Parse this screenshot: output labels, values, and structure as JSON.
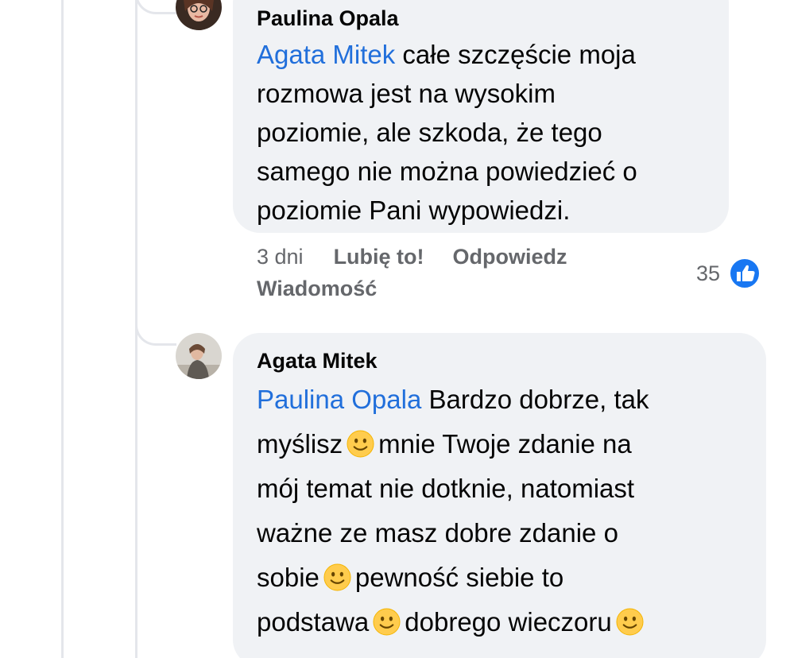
{
  "comments": [
    {
      "author": "Paulina Opala",
      "mention": "Agata Mitek",
      "lines": [
        " całe szczęście moja",
        "rozmowa jest na wysokim",
        "poziomie, ale szkoda, że tego",
        "samego nie można powiedzieć o",
        "poziomie Pani wypowiedzi."
      ],
      "time": "3 dni",
      "like_label": "Lubię to!",
      "reply_label": "Odpowiedz",
      "message_label": "Wiadomość",
      "reaction_count": "35",
      "reaction_icon": "like-icon"
    },
    {
      "author": "Agata Mitek",
      "mention": "Paulina Opala",
      "line1": " Bardzo dobrze, tak",
      "line2a": "myślisz",
      "line2b": "mnie Twoje zdanie na",
      "line3": "mój temat nie dotknie, natomiast",
      "line4": "ważne ze masz dobre zdanie o",
      "line5a": "sobie",
      "line5b": "pewność siebie to",
      "line6a": "podstawa",
      "line6b": "dobrego wieczoru",
      "emoji_icon": "slightly-smiling-face-icon"
    }
  ],
  "colors": {
    "bubble": "#f0f2f5",
    "mention": "#216fdb",
    "meta_text": "#65676b",
    "like_blue": "#1877f2"
  }
}
